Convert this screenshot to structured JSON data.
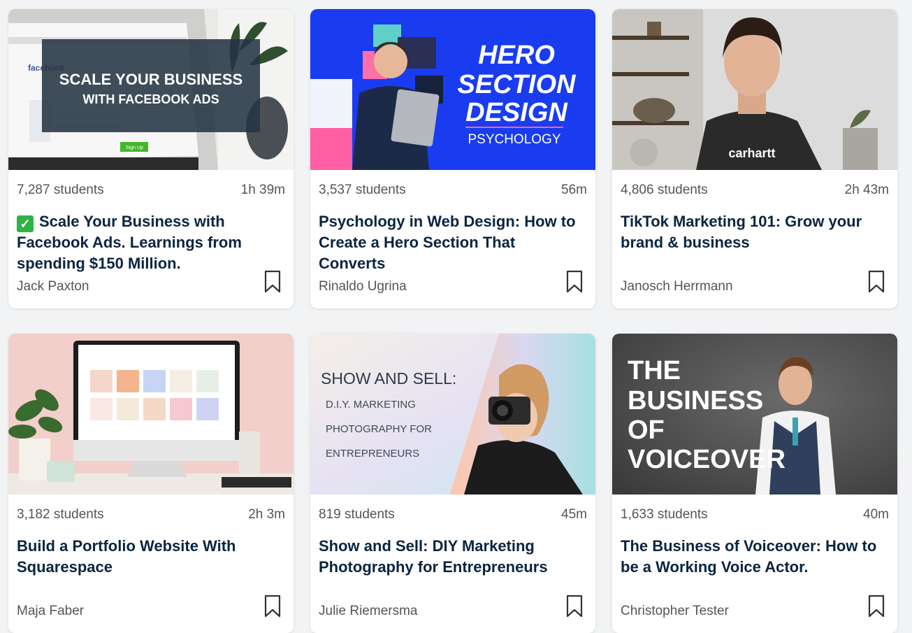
{
  "cards": [
    {
      "students": "7,287 students",
      "duration": "1h 39m",
      "check_emoji": "✓",
      "title": "Scale Your Business with Facebook Ads. Learnings from spending $150 Million.",
      "author": "Jack Paxton",
      "thumb_text": [
        "SCALE YOUR BUSINESS",
        "WITH FACEBOOK ADS"
      ],
      "thumb_screen_text": [
        "facebook",
        "Sign Up"
      ]
    },
    {
      "students": "3,537 students",
      "duration": "56m",
      "title": "Psychology in Web Design: How to Create a Hero Section That Converts",
      "author": "Rinaldo Ugrina",
      "thumb_text": [
        "HERO",
        "SECTION",
        "DESIGN",
        "PSYCHOLOGY"
      ]
    },
    {
      "students": "4,806 students",
      "duration": "2h 43m",
      "title": "TikTok Marketing 101: Grow your brand & business",
      "author": "Janosch Herrmann",
      "thumb_text": [
        "carhartt"
      ]
    },
    {
      "students": "3,182 students",
      "duration": "2h 3m",
      "title": "Build a Portfolio Website With Squarespace",
      "author": "Maja Faber",
      "thumb_text": []
    },
    {
      "students": "819 students",
      "duration": "45m",
      "title": "Show and Sell: DIY Marketing Photography for Entrepreneurs",
      "author": "Julie Riemersma",
      "thumb_text": [
        "SHOW AND SELL:",
        "D.I.Y. MARKETING",
        "PHOTOGRAPHY FOR",
        "ENTREPRENEURS"
      ]
    },
    {
      "students": "1,633 students",
      "duration": "40m",
      "title": "The Business of Voiceover: How to be a Working Voice Actor.",
      "author": "Christopher Tester",
      "thumb_text": [
        "THE",
        "BUSINESS",
        "OF",
        "VOICEOVER"
      ]
    }
  ],
  "colors": {
    "title": "#0a2540",
    "meta": "#555555",
    "check": "#2fb344",
    "hero_blue": "#1a3cf0"
  },
  "icons": {
    "bookmark": "bookmark-icon",
    "check": "check-mark-icon"
  }
}
